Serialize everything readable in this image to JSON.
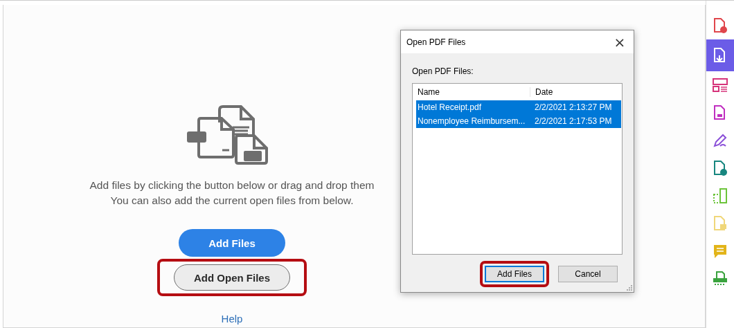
{
  "main": {
    "message_lines": [
      "Add files by clicking the button below or drag and drop them",
      "You can also add the current open files from below."
    ],
    "add_button": {
      "label": "Add Files"
    },
    "open_button": {
      "label": "Add Open Files",
      "highlighted": true
    },
    "help_link": "Help"
  },
  "dialog": {
    "title": "Open PDF Files",
    "close": "×",
    "list_label": "Open PDF Files:",
    "columns": [
      "Name",
      "Date"
    ],
    "rows": [
      {
        "name": "Hotel Receipt.pdf",
        "date": "2/2/2021 2:13:27 PM",
        "selected": true
      },
      {
        "name": "Nonemployee Reimbursem...",
        "date": "2/2/2021 2:17:53 PM",
        "selected": true
      }
    ],
    "buttons": [
      {
        "label": "Add Files",
        "highlighted": true,
        "default": true
      },
      {
        "label": "Cancel",
        "highlighted": false,
        "default": false
      }
    ]
  },
  "tools": [
    {
      "kind": "file-plus",
      "color": "#e0464c",
      "selected": false
    },
    {
      "kind": "file-down",
      "color": "#ffffff",
      "selected": true
    },
    {
      "kind": "layout",
      "color": "#d6337a",
      "selected": false
    },
    {
      "kind": "file-grid",
      "color": "#c02fc0",
      "selected": false
    },
    {
      "kind": "pen",
      "color": "#8a4fd8",
      "selected": false
    },
    {
      "kind": "file-arrow",
      "color": "#17867f",
      "selected": false
    },
    {
      "kind": "crop",
      "color": "#6cc43a",
      "selected": false
    },
    {
      "kind": "file-comment",
      "color": "#f0d77a",
      "selected": false
    },
    {
      "kind": "comment",
      "color": "#e2b419",
      "selected": false
    },
    {
      "kind": "scan",
      "color": "#3aa33e",
      "selected": false
    }
  ]
}
